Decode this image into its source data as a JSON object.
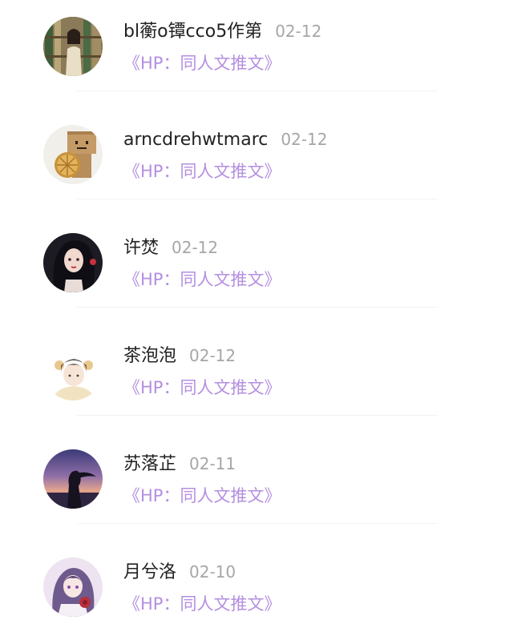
{
  "comments": [
    {
      "username": "bl蘅o镡cco5作第",
      "date": "02-12",
      "message": "《HP：同人文推文》",
      "avatar_icon": "girl-bookshelf-avatar"
    },
    {
      "username": "arncdrehwtmarc",
      "date": "02-12",
      "message": "《HP：同人文推文》",
      "avatar_icon": "danbo-orange-avatar"
    },
    {
      "username": "许焚",
      "date": "02-12",
      "message": "《HP：同人文推文》",
      "avatar_icon": "dark-hair-girl-avatar"
    },
    {
      "username": "茶泡泡",
      "date": "02-12",
      "message": "《HP：同人文推文》",
      "avatar_icon": "cartoon-boy-avatar"
    },
    {
      "username": "苏落芷",
      "date": "02-11",
      "message": "《HP：同人文推文》",
      "avatar_icon": "sunset-silhouette-avatar"
    },
    {
      "username": "月兮洛",
      "date": "02-10",
      "message": "《HP：同人文推文》",
      "avatar_icon": "anime-girl-avatar"
    }
  ],
  "colors": {
    "message": "#b48fe0",
    "username": "#222222",
    "date": "#a6a6a6"
  }
}
